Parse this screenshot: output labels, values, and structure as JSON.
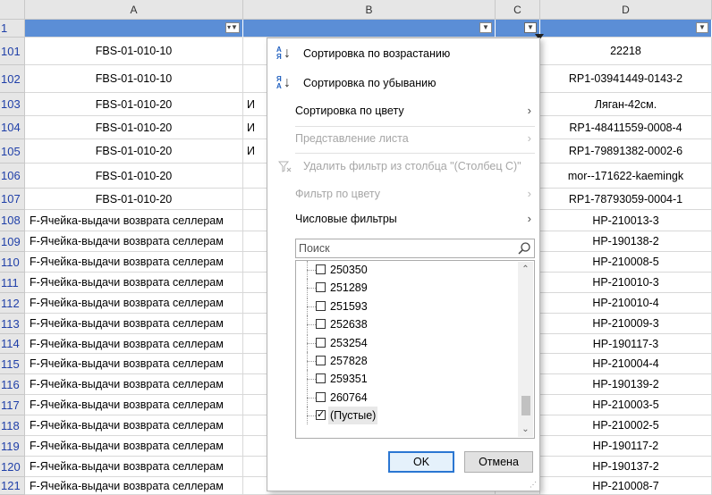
{
  "columns": [
    "A",
    "B",
    "C",
    "D"
  ],
  "header_row_number": "1",
  "rows": [
    {
      "n": "101",
      "a": "FBS-01-010-10",
      "b": "",
      "d": "22218"
    },
    {
      "n": "102",
      "a": "FBS-01-010-10",
      "b": "",
      "d": "RP1-03941449-0143-2"
    },
    {
      "n": "103",
      "a": "FBS-01-010-20",
      "b": "И",
      "d": "Ляган-42см."
    },
    {
      "n": "104",
      "a": "FBS-01-010-20",
      "b": "И",
      "d": "RP1-48411559-0008-4"
    },
    {
      "n": "105",
      "a": "FBS-01-010-20",
      "b": "И",
      "d": "RP1-79891382-0002-6"
    },
    {
      "n": "106",
      "a": "FBS-01-010-20",
      "b": "",
      "d": "mor--171622-kaemingk"
    },
    {
      "n": "107",
      "a": "FBS-01-010-20",
      "b": "",
      "d": "RP1-78793059-0004-1"
    },
    {
      "n": "108",
      "a": "F-Ячейка-выдачи возврата селлерам",
      "b": "",
      "d": "HP-210013-3"
    },
    {
      "n": "109",
      "a": "F-Ячейка-выдачи возврата селлерам",
      "b": "",
      "d": "HP-190138-2"
    },
    {
      "n": "110",
      "a": "F-Ячейка-выдачи возврата селлерам",
      "b": "",
      "d": "HP-210008-5"
    },
    {
      "n": "111",
      "a": "F-Ячейка-выдачи возврата селлерам",
      "b": "",
      "d": "HP-210010-3"
    },
    {
      "n": "112",
      "a": "F-Ячейка-выдачи возврата селлерам",
      "b": "",
      "d": "HP-210010-4"
    },
    {
      "n": "113",
      "a": "F-Ячейка-выдачи возврата селлерам",
      "b": "",
      "d": "HP-210009-3"
    },
    {
      "n": "114",
      "a": "F-Ячейка-выдачи возврата селлерам",
      "b": "",
      "d": "HP-190117-3"
    },
    {
      "n": "115",
      "a": "F-Ячейка-выдачи возврата селлерам",
      "b": "",
      "d": "HP-210004-4"
    },
    {
      "n": "116",
      "a": "F-Ячейка-выдачи возврата селлерам",
      "b": "",
      "d": "HP-190139-2"
    },
    {
      "n": "117",
      "a": "F-Ячейка-выдачи возврата селлерам",
      "b": "",
      "d": "HP-210003-5"
    },
    {
      "n": "118",
      "a": "F-Ячейка-выдачи возврата селлерам",
      "b": "",
      "d": "HP-210002-5"
    },
    {
      "n": "119",
      "a": "F-Ячейка-выдачи возврата селлерам",
      "b": "",
      "d": "HP-190117-2"
    },
    {
      "n": "120",
      "a": "F-Ячейка-выдачи возврата селлерам",
      "b": "",
      "d": "HP-190137-2"
    },
    {
      "n": "121",
      "a": "F-Ячейка-выдачи возврата селлерам",
      "b": "",
      "d": "HP-210008-7"
    }
  ],
  "menu": {
    "sort_asc": "Сортировка по возрастанию",
    "sort_desc": "Сортировка по убыванию",
    "sort_by_color": "Сортировка по цвету",
    "sheet_view": "Представление листа",
    "clear_filter": "Удалить фильтр из столбца \"(Столбец C)\"",
    "filter_by_color": "Фильтр по цвету",
    "number_filters": "Числовые фильтры",
    "sort_asc_icon_top": "А",
    "sort_asc_icon_bottom": "Я",
    "sort_desc_icon_top": "Я",
    "sort_desc_icon_bottom": "А"
  },
  "search": {
    "placeholder": "Поиск"
  },
  "filter_values": [
    {
      "label": "250350",
      "checked": false
    },
    {
      "label": "251289",
      "checked": false
    },
    {
      "label": "251593",
      "checked": false
    },
    {
      "label": "252638",
      "checked": false
    },
    {
      "label": "253254",
      "checked": false
    },
    {
      "label": "257828",
      "checked": false
    },
    {
      "label": "259351",
      "checked": false
    },
    {
      "label": "260764",
      "checked": false
    },
    {
      "label": "(Пустые)",
      "checked": true
    }
  ],
  "buttons": {
    "ok": "OK",
    "cancel": "Отмена"
  },
  "colors": {
    "header_fill": "#5b8ed6",
    "row_number": "#1f3fa8",
    "ok_border": "#2a76d2"
  },
  "icons": {
    "sort_by_arrow": "down-arrow-icon",
    "submenu": "chevron-right-icon",
    "clear_filter": "funnel-x-icon",
    "search": "magnifier-icon"
  }
}
